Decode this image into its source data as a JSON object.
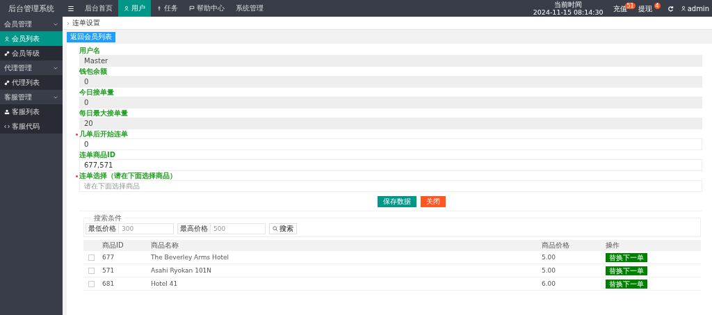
{
  "header": {
    "logo": "后台管理系统",
    "menu_icon": "☰",
    "nav": [
      {
        "label": "后台首页",
        "selected": false
      },
      {
        "label": "用户",
        "selected": true
      },
      {
        "label": "任务",
        "selected": false
      },
      {
        "label": "帮助中心",
        "selected": false
      },
      {
        "label": "系统管理",
        "selected": false
      }
    ],
    "time_label": "当前时间",
    "time": "2024-11-15 08:14:30",
    "notices": [
      {
        "label": "充值",
        "count": "51"
      },
      {
        "label": "提现",
        "count": "4"
      }
    ],
    "user": "admin"
  },
  "sidebar": [
    {
      "kind": "group",
      "label": "会员管理",
      "selected": false
    },
    {
      "kind": "item",
      "label": "会员列表",
      "selected": true
    },
    {
      "kind": "item",
      "label": "会员等级",
      "selected": false
    },
    {
      "kind": "group",
      "label": "代理管理",
      "selected": false
    },
    {
      "kind": "item",
      "label": "代理列表",
      "selected": false
    },
    {
      "kind": "group",
      "label": "客服管理",
      "selected": false
    },
    {
      "kind": "item",
      "label": "客服列表",
      "selected": false
    },
    {
      "kind": "item",
      "label": "客服代码",
      "selected": false
    }
  ],
  "breadcrumb": {
    "separator": "›",
    "label": "连单设置"
  },
  "back_button": "返回会员列表",
  "form": [
    {
      "label": "用户名",
      "value": "Master",
      "readonly": true,
      "required": false
    },
    {
      "label": "钱包余额",
      "value": "0",
      "readonly": true,
      "required": false
    },
    {
      "label": "今日接单量",
      "value": "0",
      "readonly": true,
      "required": false
    },
    {
      "label": "每日最大接单量",
      "value": "20",
      "readonly": true,
      "required": false
    },
    {
      "label": "几单后开始连单",
      "value": "0",
      "readonly": false,
      "required": true
    },
    {
      "label": "连单商品ID",
      "value": "677,571",
      "readonly": false,
      "required": false
    },
    {
      "label": "连单选择（请在下面选择商品）",
      "placeholder": "请在下面选择商品",
      "readonly": false,
      "required": true
    }
  ],
  "buttons": [
    {
      "label": "保存数据",
      "kind": "primary"
    },
    {
      "label": "关闭",
      "kind": "danger"
    }
  ],
  "search": {
    "legend": "搜索条件",
    "min_label": "最低价格",
    "min_placeholder": "300",
    "max_label": "最高价格",
    "max_placeholder": "500",
    "button": "搜索"
  },
  "table": {
    "columns": [
      "商品ID",
      "商品名称",
      "商品价格",
      "操作"
    ],
    "rows": [
      {
        "id": "677",
        "name": "The Beverley Arms Hotel",
        "price": "5.00",
        "action": "替换下一单",
        "checked": false
      },
      {
        "id": "571",
        "name": "Asahi Ryokan 101N",
        "price": "5.00",
        "action": "替换下一单",
        "checked": false
      },
      {
        "id": "681",
        "name": "Hotel 41",
        "price": "6.00",
        "action": "替换下一单",
        "checked": false
      }
    ]
  }
}
